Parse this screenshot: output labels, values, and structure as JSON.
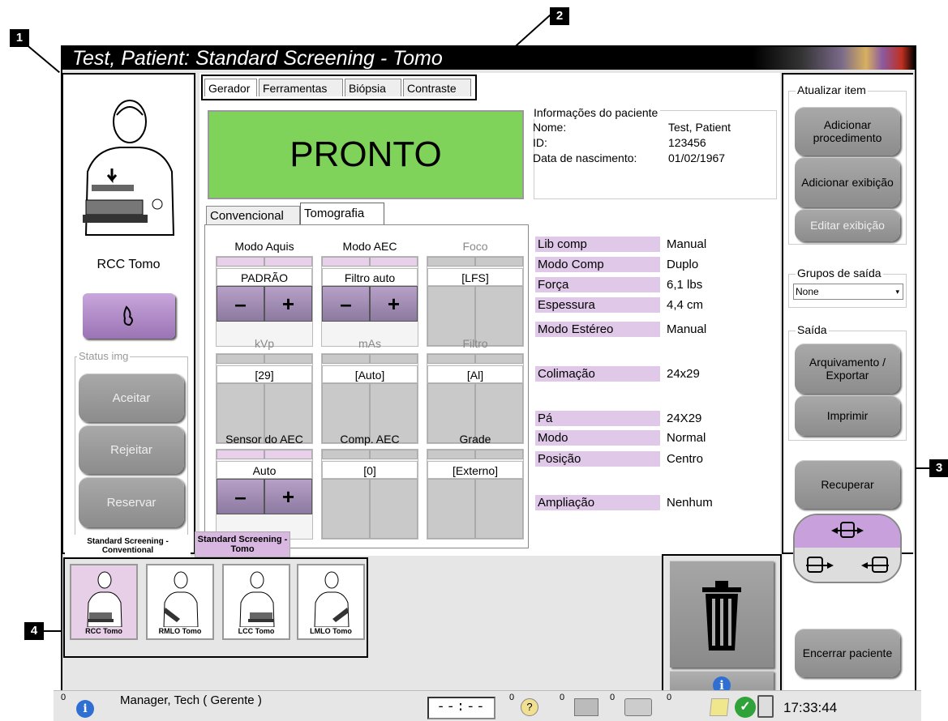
{
  "callouts": [
    "1",
    "2",
    "3",
    "4"
  ],
  "title": "Test, Patient:  Standard Screening - Tomo",
  "view_panel": {
    "view_name": "RCC Tomo",
    "image_status_label": "Status img",
    "accept": "Aceitar",
    "reject": "Rejeitar",
    "reserve": "Reservar"
  },
  "top_tabs": [
    "Gerador",
    "Ferramentas",
    "Biópsia",
    "Contraste"
  ],
  "ready_text": "PRONTO",
  "patient_info": {
    "header": "Informações do paciente",
    "name_label": "Nome:",
    "name_value": "Test, Patient",
    "id_label": "ID:",
    "id_value": "123456",
    "dob_label": "Data de nascimento:",
    "dob_value": "01/02/1967"
  },
  "mode_tabs": [
    "Convencional",
    "Tomografia"
  ],
  "controls": {
    "acq_mode": {
      "label": "Modo Aquis",
      "value": "PADRÃO"
    },
    "aec_mode": {
      "label": "Modo AEC",
      "value": "Filtro auto"
    },
    "focus": {
      "label": "Foco",
      "value": "[LFS]"
    },
    "kvp": {
      "label": "kVp",
      "value": "[29]"
    },
    "mas": {
      "label": "mAs",
      "value": "[Auto]"
    },
    "filter": {
      "label": "Filtro",
      "value": "[Al]"
    },
    "aec_sensor": {
      "label": "Sensor do AEC",
      "value": "Auto"
    },
    "aec_comp": {
      "label": "Comp. AEC",
      "value": "[0]"
    },
    "grid": {
      "label": "Grade",
      "value": "[Externo]"
    },
    "minus": "–",
    "plus": "+"
  },
  "exam_info": [
    {
      "label": "Lib comp",
      "value": "Manual"
    },
    {
      "label": "Modo Comp",
      "value": "Duplo"
    },
    {
      "label": "Força",
      "value": "6,1 lbs"
    },
    {
      "label": "Espessura",
      "value": "4,4 cm"
    },
    {
      "label": "Modo Estéreo",
      "value": "Manual"
    },
    {
      "label": "Colimação",
      "value": "24x29"
    },
    {
      "label": "Pá",
      "value": "24X29"
    },
    {
      "label": "Modo",
      "value": "Normal"
    },
    {
      "label": "Posição",
      "value": "Centro"
    },
    {
      "label": "Ampliação",
      "value": "Nenhum"
    }
  ],
  "right_panel": {
    "update_item": "Atualizar item",
    "add_procedure": "Adicionar procedimento",
    "add_view": "Adicionar exibição",
    "edit_view": "Editar exibição",
    "output_groups": "Grupos de saída",
    "output_group_value": "None",
    "output": "Saída",
    "archive_export": "Arquivamento / Exportar",
    "print": "Imprimir",
    "retrieve": "Recuperar",
    "close_patient": "Encerrar paciente"
  },
  "procedure_tabs": [
    "Standard Screening - Conventional",
    "Standard Screening - Tomo"
  ],
  "thumbnails": [
    "RCC Tomo",
    "RMLO Tomo",
    "LCC Tomo",
    "LMLO Tomo"
  ],
  "status_bar": {
    "count0": "0",
    "user": "Manager, Tech ( Gerente )",
    "timer": "--:--",
    "c1": "0",
    "c2": "0",
    "c3": "0",
    "c4": "0",
    "time": "17:33:44"
  },
  "colors": {
    "ready": "#7fd25a",
    "accent_purple": "#b58ccc",
    "pink_label": "#e0c8e8"
  }
}
